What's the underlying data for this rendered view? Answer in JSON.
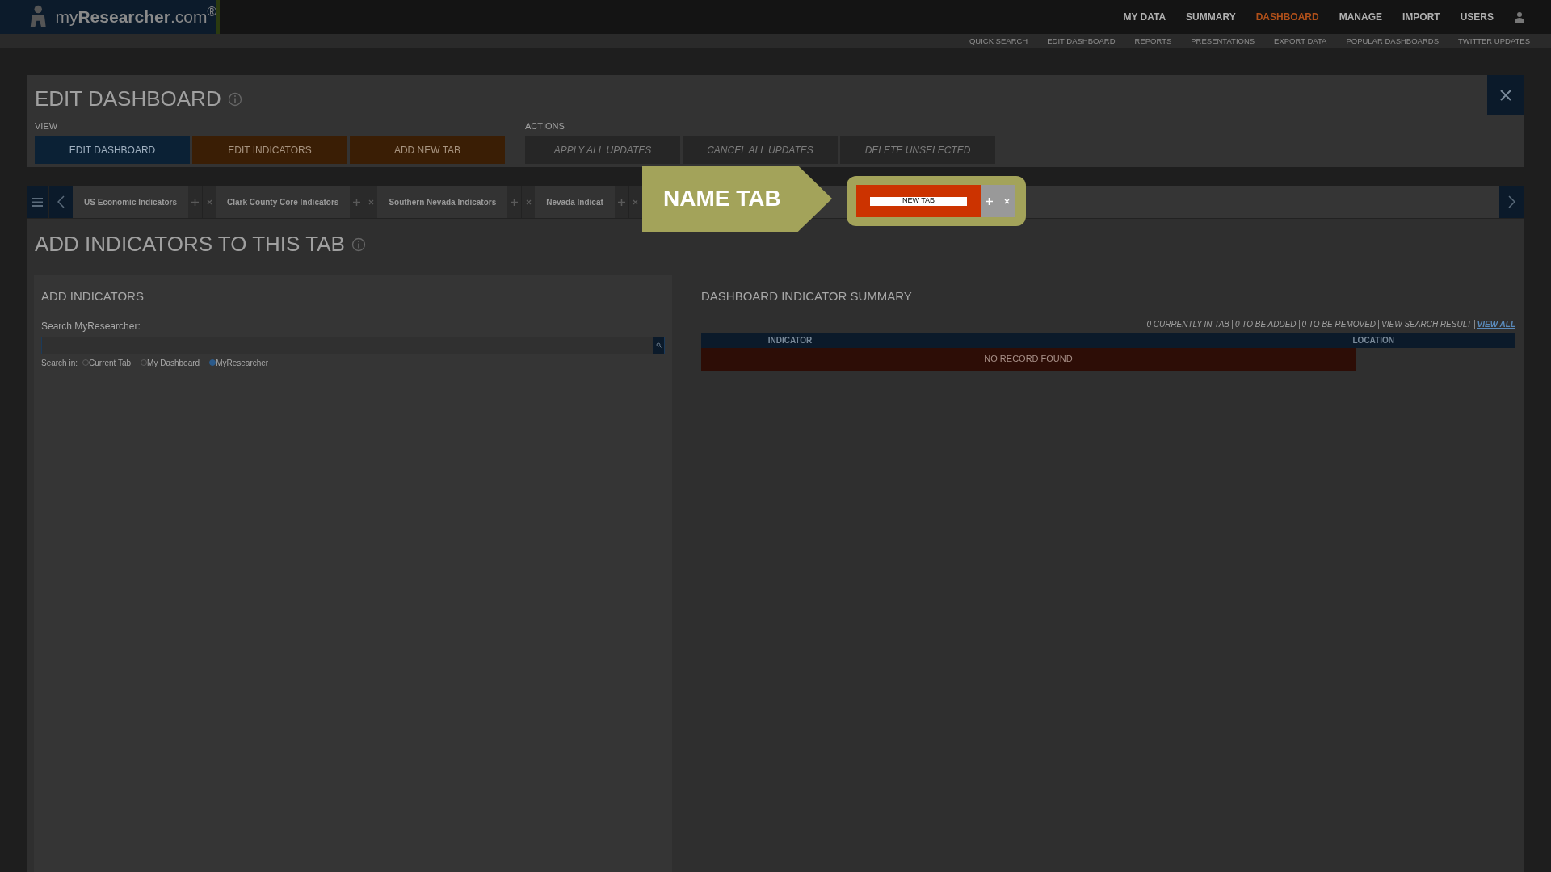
{
  "header": {
    "logo": "my**Researcher**.com$^{®}$",
    "nav": [
      {
        "label": "MY DATA",
        "selected": false
      },
      {
        "label": "SUMMARY",
        "selected": false
      },
      {
        "label": "DASHBOARD",
        "selected": true
      },
      {
        "label": "MANAGE",
        "selected": false
      },
      {
        "label": "IMPORT",
        "selected": false
      },
      {
        "label": "USERS",
        "selected": false
      }
    ],
    "subnav": [
      "QUICK SEARCH",
      "EDIT DASHBOARD",
      "REPORTS",
      "PRESENTATIONS",
      "EXPORT DATA",
      "POPULAR DASHBOARDS",
      "TWITTER UPDATES"
    ]
  },
  "edit_panel": {
    "title": "EDIT DASHBOARD",
    "view_label": "VIEW",
    "view_buttons": [
      {
        "label": "EDIT DASHBOARD",
        "selected": true
      },
      {
        "label": "EDIT INDICATORS",
        "selected": false
      },
      {
        "label": "ADD NEW TAB",
        "selected": false
      }
    ],
    "actions_label": "ACTIONS",
    "action_buttons": [
      {
        "label": "APPLY ALL UPDATES",
        "disabled": true
      },
      {
        "label": "CANCEL ALL UPDATES",
        "disabled": true
      },
      {
        "label": "DELETE UNSELECTED",
        "disabled": true
      }
    ]
  },
  "tabs": [
    {
      "label": "US Economic Indicators"
    },
    {
      "label": "Clark County Core Indicators"
    },
    {
      "label": "Southern Nevada Indicators"
    },
    {
      "label": "Nevada Indicat"
    }
  ],
  "callout": {
    "title": "NAME TAB",
    "new_tab_value": "NEW TAB"
  },
  "section_title": "ADD INDICATORS TO THIS TAB",
  "add_indicators": {
    "title": "ADD INDICATORS",
    "search_label": "Search MyResearcher:",
    "search_in_label": "Search in:",
    "scopes": [
      {
        "label": "Current Tab",
        "selected": false
      },
      {
        "label": "My Dashboard",
        "selected": false
      },
      {
        "label": "MyResearcher",
        "selected": true
      }
    ]
  },
  "summary": {
    "title": "DASHBOARD INDICATOR SUMMARY",
    "stats": [
      "0 CURRENTLY IN TAB",
      "0 TO BE ADDED",
      "0 TO BE REMOVED",
      "VIEW SEARCH RESULT"
    ],
    "view_all": "VIEW ALL",
    "columns": [
      "INDICATOR",
      "LOCATION"
    ],
    "empty_message": "NO RECORD FOUND"
  }
}
